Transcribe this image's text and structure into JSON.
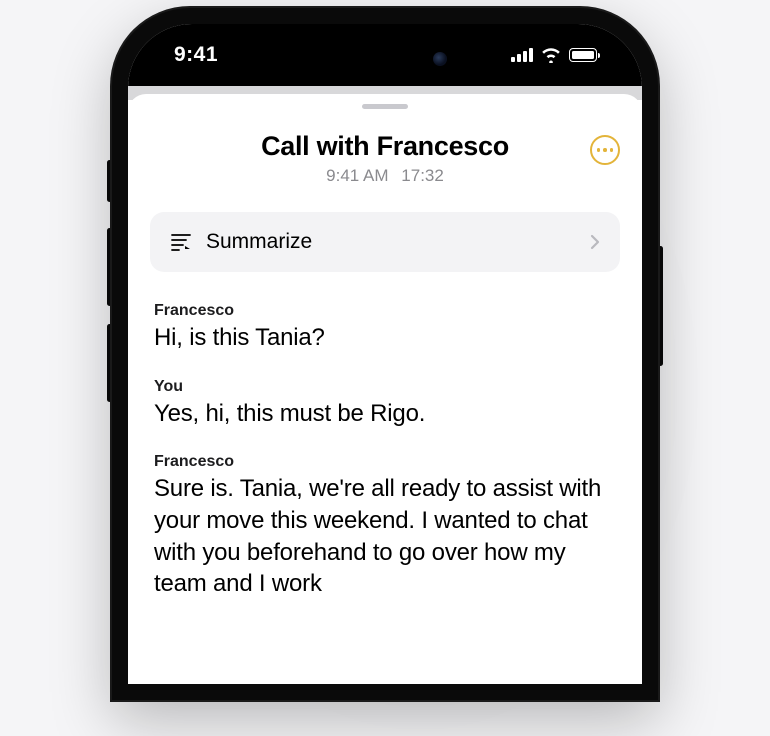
{
  "status_bar": {
    "time": "9:41"
  },
  "header": {
    "title": "Call with Francesco",
    "timestamp": "9:41 AM",
    "duration": "17:32"
  },
  "summarize": {
    "label": "Summarize"
  },
  "transcript": [
    {
      "speaker": "Francesco",
      "text": "Hi, is this Tania?"
    },
    {
      "speaker": "You",
      "text": "Yes, hi, this must be Rigo."
    },
    {
      "speaker": "Francesco",
      "text": "Sure is. Tania, we're all ready to assist with your move this weekend. I wanted to chat with you beforehand to go over how my team and I work"
    }
  ],
  "colors": {
    "accent": "#e3b43a"
  }
}
